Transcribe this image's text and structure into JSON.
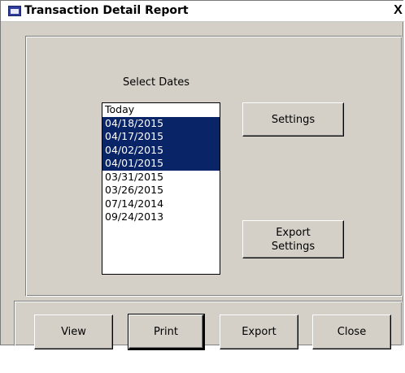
{
  "window": {
    "title": "Transaction Detail Report",
    "close_glyph": "X"
  },
  "dates_label": "Select Dates",
  "dates": [
    {
      "label": "Today",
      "selected": false
    },
    {
      "label": "04/18/2015",
      "selected": true
    },
    {
      "label": "04/17/2015",
      "selected": true
    },
    {
      "label": "04/02/2015",
      "selected": true
    },
    {
      "label": "04/01/2015",
      "selected": true
    },
    {
      "label": "03/31/2015",
      "selected": false
    },
    {
      "label": "03/26/2015",
      "selected": false
    },
    {
      "label": "07/14/2014",
      "selected": false
    },
    {
      "label": "09/24/2013",
      "selected": false
    }
  ],
  "buttons": {
    "settings": "Settings",
    "export_settings": "Export\nSettings",
    "view": "View",
    "print": "Print",
    "export": "Export",
    "close": "Close"
  },
  "colors": {
    "selection": "#0a2468",
    "dialog_face": "#d4d0c8"
  }
}
